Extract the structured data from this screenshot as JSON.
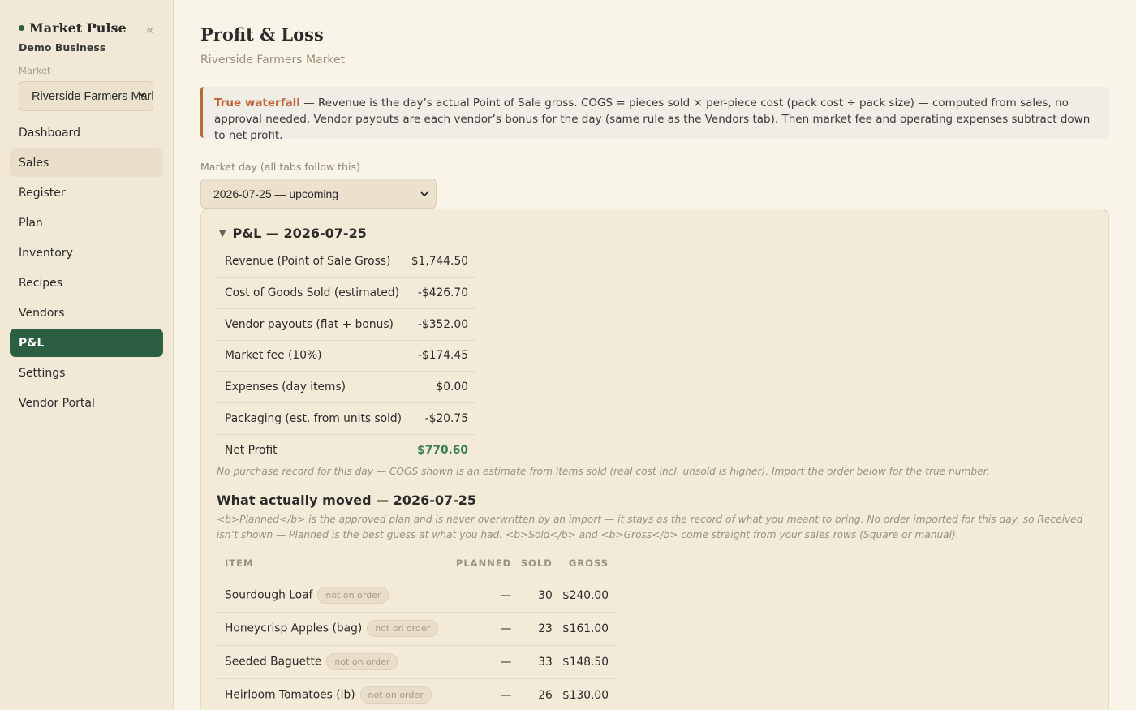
{
  "sidebar": {
    "brand": "Market Pulse",
    "business": "Demo Business",
    "market_label": "Market",
    "market_value": "Riverside Farmers Market",
    "collapse_glyph": "«",
    "items": [
      {
        "label": "Dashboard"
      },
      {
        "label": "Sales"
      },
      {
        "label": "Register"
      },
      {
        "label": "Plan"
      },
      {
        "label": "Inventory"
      },
      {
        "label": "Recipes"
      },
      {
        "label": "Vendors"
      },
      {
        "label": "P&L"
      },
      {
        "label": "Settings"
      },
      {
        "label": "Vendor Portal"
      }
    ],
    "active": "P&L"
  },
  "header": {
    "title": "Profit & Loss",
    "subtitle": "Riverside Farmers Market"
  },
  "callout": {
    "strong": "True waterfall",
    "text": " — Revenue is the day’s actual Point of Sale gross. COGS = pieces sold × per-piece cost (pack cost ÷ pack size) — computed from sales, no approval needed. Vendor payouts are each vendor’s bonus for the day (same rule as the Vendors tab). Then market fee and operating expenses subtract down to net profit."
  },
  "day": {
    "label": "Market day (all tabs follow this)",
    "value": "2026-07-25 — upcoming"
  },
  "pl": {
    "heading": "P&L — 2026-07-25",
    "rows": [
      {
        "label": "Revenue (Point of Sale Gross)",
        "value": "$1,744.50"
      },
      {
        "label": "Cost of Goods Sold (estimated)",
        "value": "-$426.70"
      },
      {
        "label": "Vendor payouts (flat + bonus)",
        "value": "-$352.00"
      },
      {
        "label": "Market fee (10%)",
        "value": "-$174.45"
      },
      {
        "label": "Expenses (day items)",
        "value": "$0.00"
      },
      {
        "label": "Packaging (est. from units sold)",
        "value": "-$20.75"
      },
      {
        "label": "Net Profit",
        "value": "$770.60"
      }
    ],
    "note": "No purchase record for this day — COGS shown is an estimate from items sold (real cost incl. unsold is higher). Import the order below for the true number."
  },
  "moved": {
    "heading": "What actually moved — 2026-07-25",
    "note": "<b>Planned</b> is the approved plan and is never overwritten by an import — it stays as the record of what you meant to bring. No order imported for this day, so Received isn’t shown — Planned is the best guess at what you had. <b>Sold</b> and <b>Gross</b> come straight from your sales rows (Square or manual).",
    "columns": [
      "ITEM",
      "PLANNED",
      "SOLD",
      "GROSS"
    ],
    "rows": [
      {
        "item": "Sourdough Loaf",
        "badge": "not on order",
        "planned": "—",
        "sold": "30",
        "gross": "$240.00"
      },
      {
        "item": "Honeycrisp Apples (bag)",
        "badge": "not on order",
        "planned": "—",
        "sold": "23",
        "gross": "$161.00"
      },
      {
        "item": "Seeded Baguette",
        "badge": "not on order",
        "planned": "—",
        "sold": "33",
        "gross": "$148.50"
      },
      {
        "item": "Heirloom Tomatoes (lb)",
        "badge": "not on order",
        "planned": "—",
        "sold": "26",
        "gross": "$130.00"
      }
    ]
  },
  "colors": {
    "accent": "#2c5e41",
    "callout_accent": "#c0663d",
    "net_profit": "#3b7d52"
  }
}
